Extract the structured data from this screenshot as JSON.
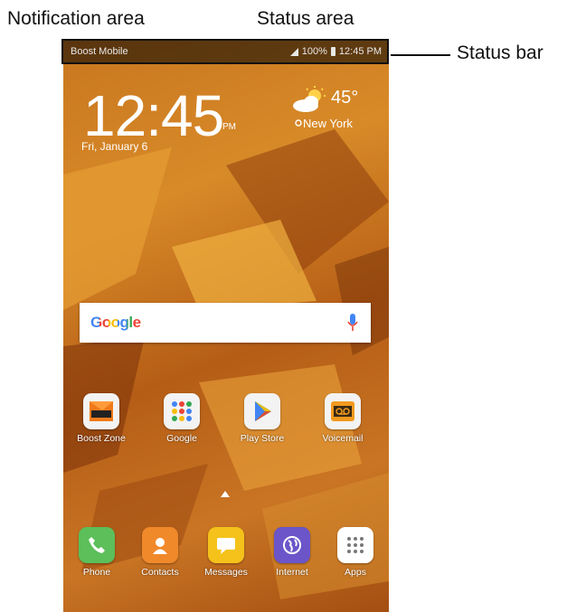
{
  "callouts": {
    "notification_area": "Notification area",
    "status_area": "Status area",
    "status_bar": "Status bar"
  },
  "status_bar": {
    "carrier": "Boost Mobile",
    "battery": "100%",
    "time": "12:45 PM"
  },
  "lock_widget": {
    "clock": "12:45",
    "ampm": "PM",
    "date": "Fri, January 6",
    "temperature": "45°",
    "city": "New York"
  },
  "search": {
    "logo": "Google"
  },
  "home_apps": [
    {
      "label": "Boost Zone",
      "icon": "boost-zone-icon"
    },
    {
      "label": "Google",
      "icon": "google-folder-icon"
    },
    {
      "label": "Play Store",
      "icon": "play-store-icon"
    },
    {
      "label": "Voicemail",
      "icon": "voicemail-icon"
    }
  ],
  "dock_apps": [
    {
      "label": "Phone",
      "icon": "phone-icon"
    },
    {
      "label": "Contacts",
      "icon": "contacts-icon"
    },
    {
      "label": "Messages",
      "icon": "messages-icon"
    },
    {
      "label": "Internet",
      "icon": "internet-icon"
    },
    {
      "label": "Apps",
      "icon": "apps-grid-icon"
    }
  ],
  "colors": {
    "wallpaper": "#c8761f",
    "phone_green": "#5cbf5a",
    "contacts_orange": "#f0892a",
    "messages_yellow": "#f4c21a",
    "internet_purple": "#6b55c9"
  }
}
